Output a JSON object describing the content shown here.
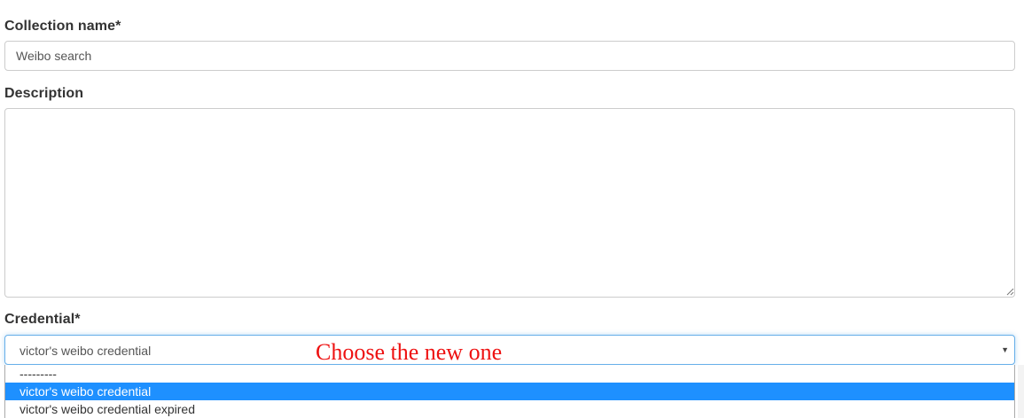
{
  "form": {
    "collection_name": {
      "label": "Collection name*",
      "value": "Weibo search"
    },
    "description": {
      "label": "Description",
      "value": ""
    },
    "credential": {
      "label": "Credential*",
      "selected": "victor's weibo credential",
      "options": [
        "---------",
        "victor's weibo credential",
        "victor's weibo credential expired"
      ],
      "highlighted_index": 1
    }
  },
  "annotation": {
    "text": "Choose the new one",
    "color": "#ee1111"
  },
  "colors": {
    "highlight": "#1e90ff",
    "focus_border": "#66afe9"
  },
  "icons": {
    "select_arrow": "chevron-down-icon",
    "resize_grip": "resize-grip-icon"
  }
}
